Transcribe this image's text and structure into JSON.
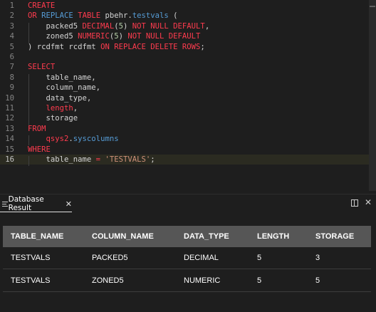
{
  "editor": {
    "lines": [
      {
        "n": "1",
        "tokens": [
          {
            "t": "CREATE",
            "c": "kw"
          }
        ]
      },
      {
        "n": "2",
        "tokens": [
          {
            "t": "OR",
            "c": "kw"
          },
          {
            "t": " "
          },
          {
            "t": "REPLACE",
            "c": "sys"
          },
          {
            "t": " "
          },
          {
            "t": "TABLE",
            "c": "kw"
          },
          {
            "t": " "
          },
          {
            "t": "pbehr",
            "c": "sch"
          },
          {
            "t": "."
          },
          {
            "t": "testvals",
            "c": "sys"
          },
          {
            "t": " ("
          }
        ]
      },
      {
        "n": "3",
        "tokens": [
          {
            "t": "    packed5 "
          },
          {
            "t": "DECIMAL",
            "c": "type"
          },
          {
            "t": "("
          },
          {
            "t": "5",
            "c": "num"
          },
          {
            "t": ") "
          },
          {
            "t": "NOT NULL DEFAULT",
            "c": "kw"
          },
          {
            "t": ","
          }
        ]
      },
      {
        "n": "4",
        "tokens": [
          {
            "t": "    zoned5 "
          },
          {
            "t": "NUMERIC",
            "c": "type"
          },
          {
            "t": "("
          },
          {
            "t": "5",
            "c": "num"
          },
          {
            "t": ") "
          },
          {
            "t": "NOT NULL DEFAULT",
            "c": "kw"
          }
        ]
      },
      {
        "n": "5",
        "tokens": [
          {
            "t": ") rcdfmt rcdfmt "
          },
          {
            "t": "ON",
            "c": "kw"
          },
          {
            "t": " "
          },
          {
            "t": "REPLACE DELETE ROWS",
            "c": "kw"
          },
          {
            "t": ";"
          }
        ]
      },
      {
        "n": "6",
        "tokens": []
      },
      {
        "n": "7",
        "tokens": [
          {
            "t": "SELECT",
            "c": "kw"
          }
        ]
      },
      {
        "n": "8",
        "tokens": [
          {
            "t": "    table_name,"
          }
        ]
      },
      {
        "n": "9",
        "tokens": [
          {
            "t": "    column_name,"
          }
        ]
      },
      {
        "n": "10",
        "tokens": [
          {
            "t": "    data_type,"
          }
        ]
      },
      {
        "n": "11",
        "tokens": [
          {
            "t": "    "
          },
          {
            "t": "length",
            "c": "kw"
          },
          {
            "t": ","
          }
        ]
      },
      {
        "n": "12",
        "tokens": [
          {
            "t": "    storage"
          }
        ]
      },
      {
        "n": "13",
        "tokens": [
          {
            "t": "FROM",
            "c": "kw"
          }
        ]
      },
      {
        "n": "14",
        "tokens": [
          {
            "t": "    "
          },
          {
            "t": "qsys2",
            "c": "kw"
          },
          {
            "t": "."
          },
          {
            "t": "syscolumns",
            "c": "sys"
          }
        ]
      },
      {
        "n": "15",
        "tokens": [
          {
            "t": "WHERE",
            "c": "kw"
          }
        ]
      },
      {
        "n": "16",
        "tokens": [
          {
            "t": "    table_name "
          },
          {
            "t": "=",
            "c": "kw"
          },
          {
            "t": " "
          },
          {
            "t": "'TESTVALS'",
            "c": "str"
          },
          {
            "t": ";"
          }
        ]
      }
    ],
    "current_line": "16",
    "colors": {
      "keyword": "#ff3b4e",
      "system_identifier": "#569cd6",
      "number": "#b5cea8",
      "string": "#ce9178",
      "text": "#d4d4d4"
    }
  },
  "panel": {
    "tab_label": "Database Result",
    "tab_icon": "list-icon",
    "close_tab_icon": "close-icon",
    "split_icon": "split-editor-icon",
    "close_panel_icon": "close-icon"
  },
  "results": {
    "columns": [
      "TABLE_NAME",
      "COLUMN_NAME",
      "DATA_TYPE",
      "LENGTH",
      "STORAGE"
    ],
    "rows": [
      [
        "TESTVALS",
        "PACKED5",
        "DECIMAL",
        "5",
        "3"
      ],
      [
        "TESTVALS",
        "ZONED5",
        "NUMERIC",
        "5",
        "5"
      ]
    ]
  }
}
